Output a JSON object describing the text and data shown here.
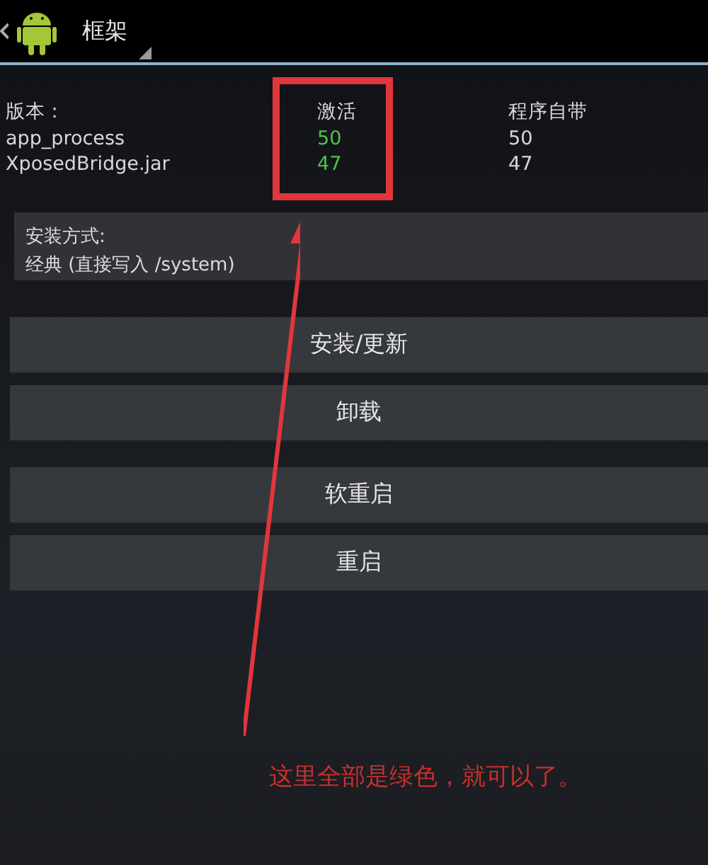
{
  "action_bar": {
    "title": "框架"
  },
  "versions": {
    "label": "版本 :",
    "columns": [
      "激活",
      "程序自带"
    ],
    "rows": [
      {
        "name": "app_process",
        "active": "50",
        "bundled": "50",
        "active_ok": true
      },
      {
        "name": "XposedBridge.jar",
        "active": "47",
        "bundled": "47",
        "active_ok": true
      }
    ]
  },
  "install_mode": {
    "label": "安装方式:",
    "value": "经典 (直接写入 /system)"
  },
  "button_groups": [
    [
      "安装/更新",
      "卸载"
    ],
    [
      "软重启",
      "重启"
    ]
  ],
  "annotation": {
    "note": "这里全部是绿色，就可以了。"
  }
}
